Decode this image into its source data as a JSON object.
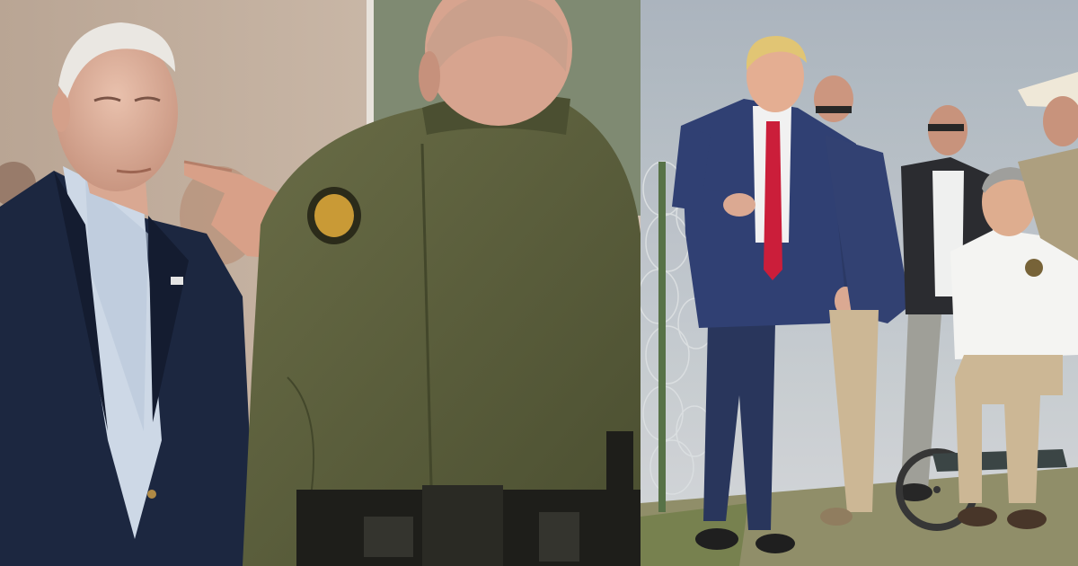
{
  "collage": {
    "panels": [
      {
        "id": "left",
        "scene": "indoor-briefing"
      },
      {
        "id": "right",
        "scene": "outdoor-border-fence"
      }
    ]
  },
  "colors": {
    "indoor_wall": "#c9b8a8",
    "navy_suit": "#1c2740",
    "olive_uniform": "#5b5f3d",
    "tie_red": "#c8102e",
    "sky": "#b4bcc4",
    "grass": "#6f7a45",
    "khaki": "#c9b38f"
  }
}
